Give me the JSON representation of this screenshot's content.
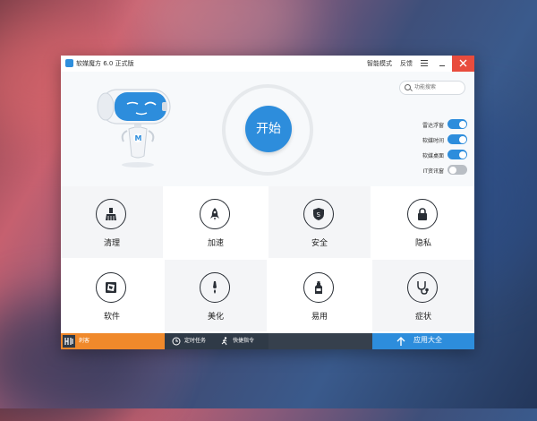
{
  "window": {
    "title": "软媒魔方 6.0 正式版"
  },
  "titlebar": {
    "smart_mode": "智能模式",
    "feedback": "反馈"
  },
  "search": {
    "placeholder": "功能搜索"
  },
  "start": {
    "label": "开始"
  },
  "toggles": [
    {
      "label": "雷达浮窗",
      "on": true
    },
    {
      "label": "软媒时间",
      "on": true
    },
    {
      "label": "软媒桌面",
      "on": true
    },
    {
      "label": "IT资讯窗",
      "on": false
    }
  ],
  "tiles": [
    {
      "label": "清理",
      "icon": "broom-icon"
    },
    {
      "label": "加速",
      "icon": "rocket-icon"
    },
    {
      "label": "安全",
      "icon": "shield-icon"
    },
    {
      "label": "隐私",
      "icon": "lock-icon"
    },
    {
      "label": "软件",
      "icon": "aperture-icon"
    },
    {
      "label": "美化",
      "icon": "brush-icon"
    },
    {
      "label": "易用",
      "icon": "bottle-icon"
    },
    {
      "label": "症状",
      "icon": "stethoscope-icon"
    }
  ],
  "bottom": {
    "news": "刺客",
    "scheduled": "定时任务",
    "quick": "快捷指令",
    "apps": "应用大全"
  },
  "colors": {
    "accent": "#2d8ddc",
    "close": "#e84c3d",
    "orange": "#f0892b",
    "dark": "#2f3a47"
  }
}
